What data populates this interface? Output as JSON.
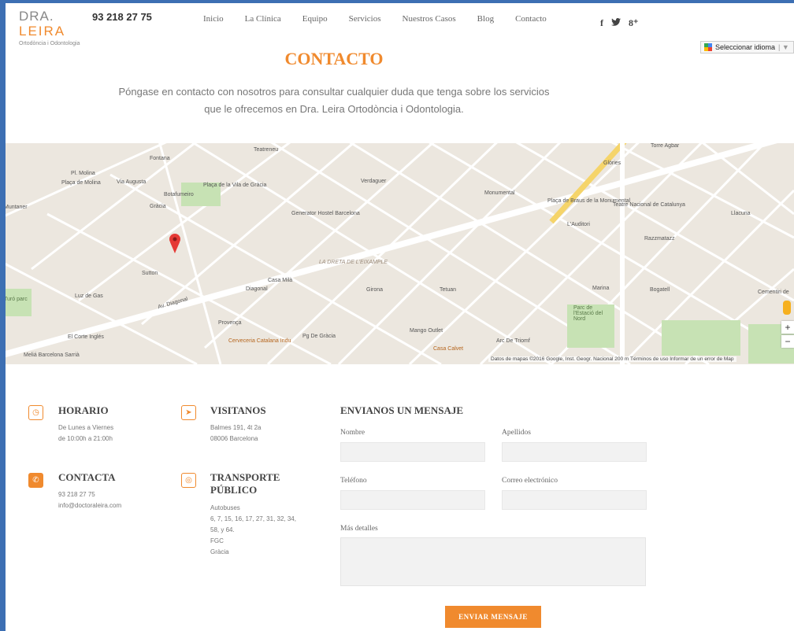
{
  "header": {
    "logo_line1": "DRA.",
    "logo_line2": "LEIRA",
    "logo_tagline": "Ortodòncia i Odontologia",
    "phone": "93 218 27 75",
    "nav": [
      "Inicio",
      "La Clínica",
      "Equipo",
      "Servicios",
      "Nuestros Casos",
      "Blog",
      "Contacto"
    ],
    "social": [
      "f",
      "𝕥",
      "8⁺"
    ],
    "language_select": "Seleccionar idioma"
  },
  "page": {
    "title": "CONTACTO",
    "intro": "Póngase en contacto con nosotros para consultar cualquier duda que tenga sobre los servicios que le ofrecemos en Dra. Leira Ortodòncia i Odontologia."
  },
  "map": {
    "labels": [
      "Fontana",
      "Pl. Molina",
      "Plaça de Molina",
      "Via Augusta",
      "Gràcia",
      "Botafumeiro",
      "Plaça de la Vila de Gràcia",
      "Teatreneu",
      "Generator Hostel Barcelona",
      "Verdaguer",
      "Monumental",
      "Plaça de Braus de la Monumental",
      "Teatre Nacional de Catalunya",
      "Glòries",
      "Torre Agbar",
      "Llacuna",
      "Muntaner",
      "Sutton",
      "Luz de Gas",
      "Av. Diagonal",
      "Diagonal",
      "Casa Milà",
      "LA DRETA DE L'EIXAMPLE",
      "Girona",
      "Tetuan",
      "L'Auditori",
      "Razzmatazz",
      "Marina",
      "Bogatell",
      "Parc de l'Estació del Nord",
      "Provença",
      "Cerveceria Catalana Indu",
      "Pg De Gràcia",
      "El Corte Inglés",
      "Mango Outlet",
      "Casa Calvet",
      "Arc De Triomf",
      "Meliá Barcelona Sarrià",
      "Turó parc",
      "Cementiri de"
    ],
    "footer": "Datos de mapas ©2016 Google, Inst. Geogr. Nacional   200 m         Términos de uso   Informar de un error de Map",
    "zoom_in": "+",
    "zoom_out": "−"
  },
  "info": {
    "horario": {
      "title": "HORARIO",
      "text": "De Lunes a Viernes\nde 10:00h a 21:00h"
    },
    "visitanos": {
      "title": "VISITANOS",
      "text": "Balmes 191, 4t 2a\n08006 Barcelona"
    },
    "contacta": {
      "title": "CONTACTA",
      "text": "93 218 27 75\ninfo@doctoraleira.com"
    },
    "transporte": {
      "title": "TRANSPORTE\nPÚBLICO",
      "text": "Autobuses\n6, 7, 15, 16, 17, 27, 31, 32, 34,\n58, y 64.\nFGC\nGràcia"
    }
  },
  "form": {
    "heading": "ENVIANOS UN MENSAJE",
    "nombre": "Nombre",
    "apellidos": "Apellidos",
    "telefono": "Teléfono",
    "correo": "Correo electrónico",
    "detalles": "Más detalles",
    "submit": "ENVIAR MENSAJE"
  },
  "colors": {
    "accent": "#f08a2e",
    "frame": "#3d6fb3"
  }
}
